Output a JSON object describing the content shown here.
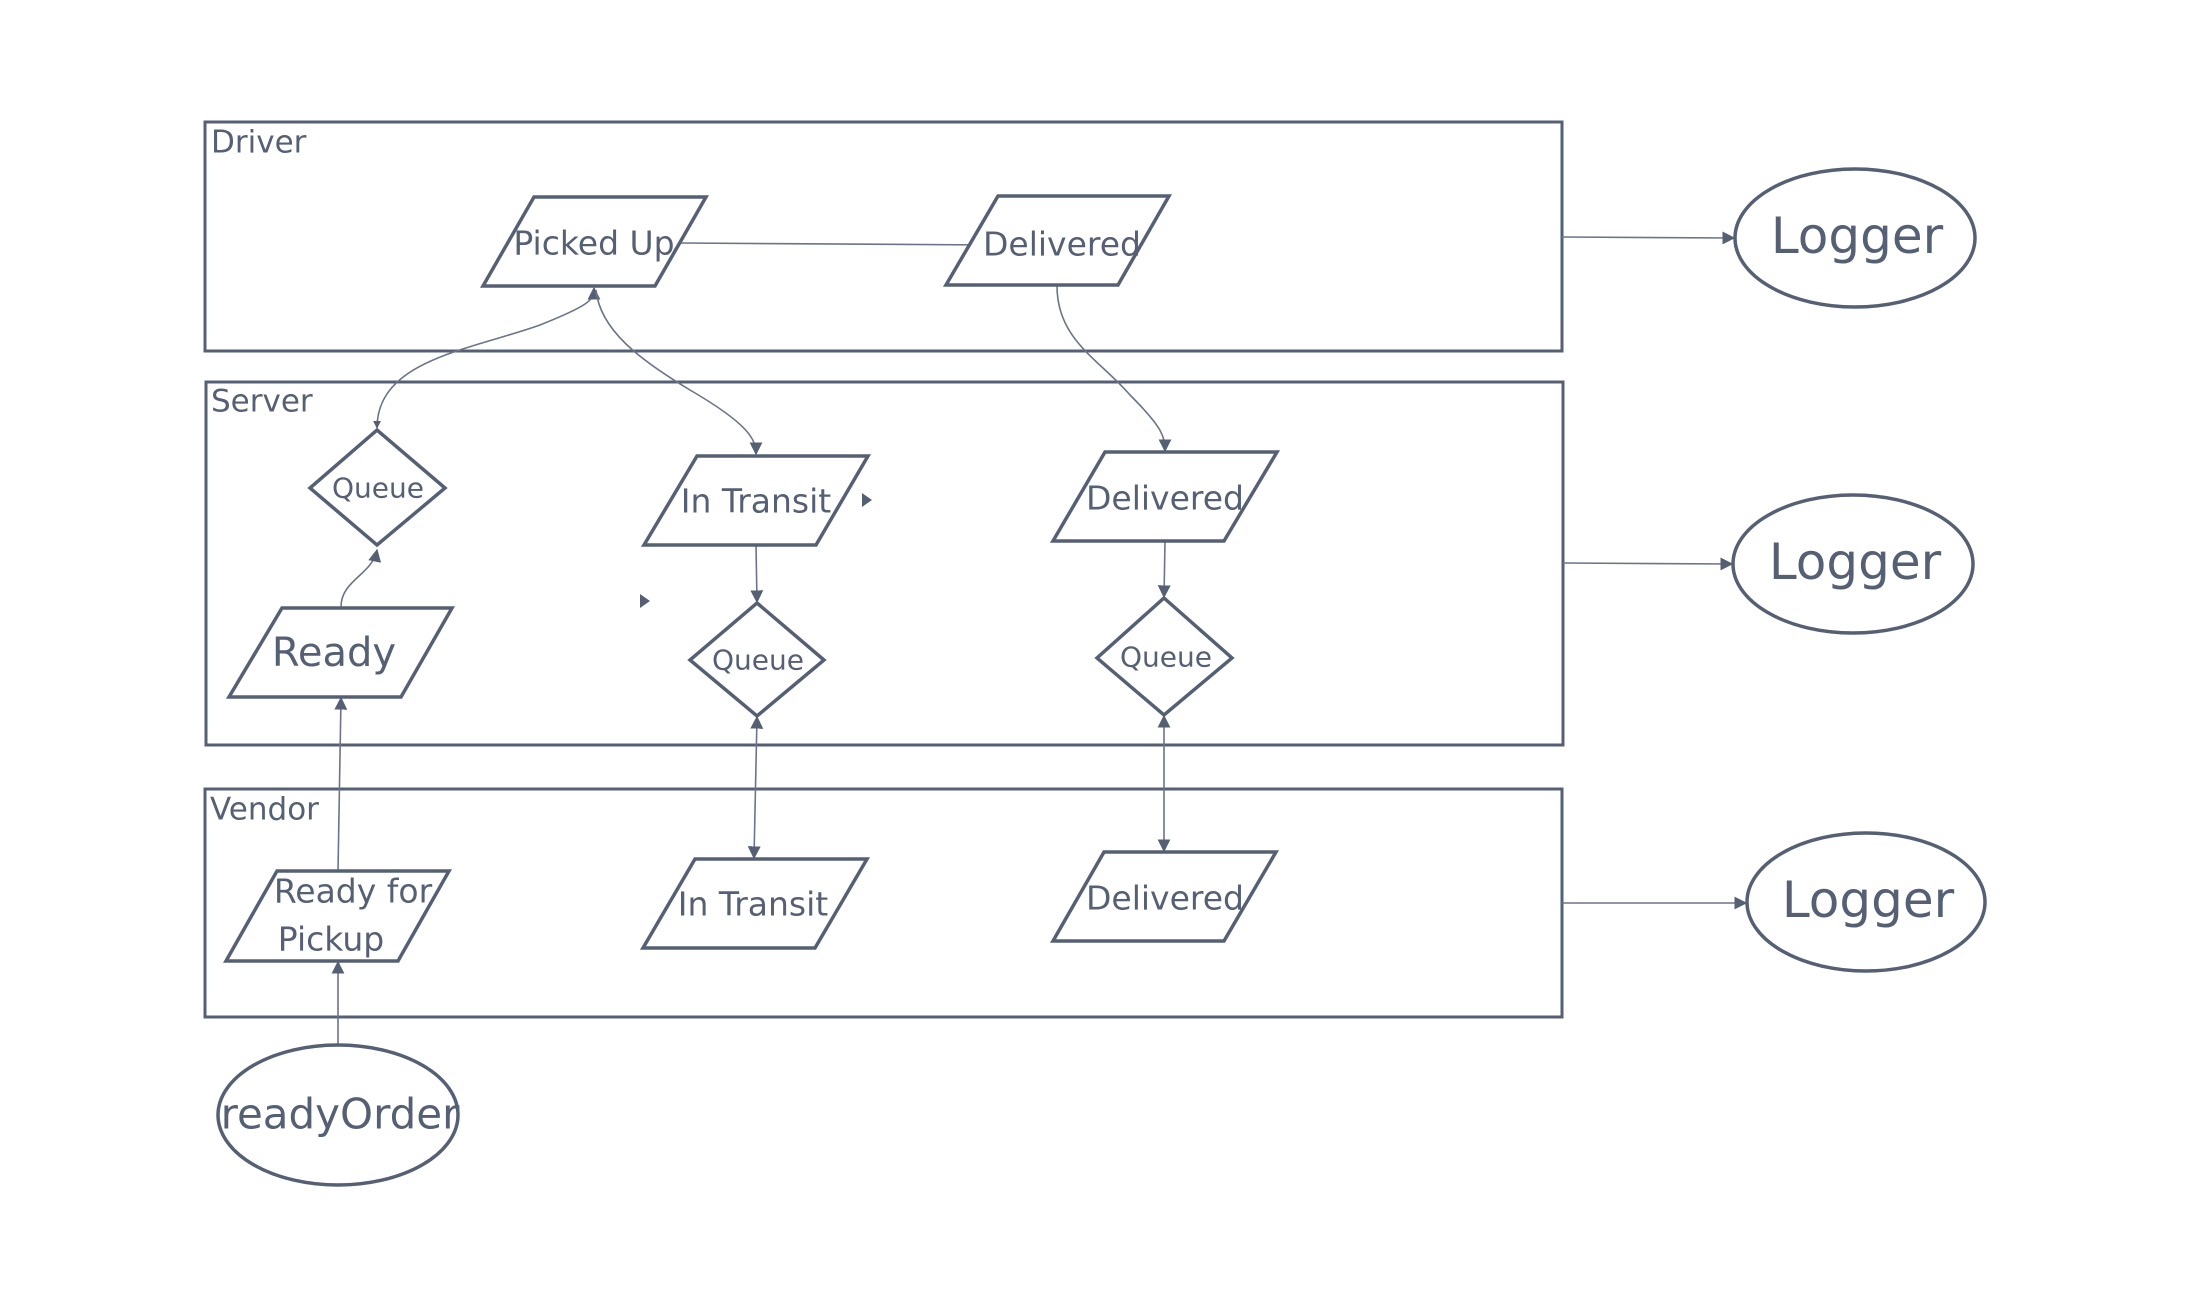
{
  "diagram": {
    "stroke_color": "#566074",
    "edge_color": "#6b7488",
    "lanes": [
      {
        "id": "driver",
        "title": "Driver"
      },
      {
        "id": "server",
        "title": "Server"
      },
      {
        "id": "vendor",
        "title": "Vendor"
      }
    ],
    "nodes": {
      "driver_picked_up": {
        "label": "Picked Up",
        "shape": "parallelogram",
        "lane": "driver"
      },
      "driver_delivered": {
        "label": "Delivered",
        "shape": "parallelogram",
        "lane": "driver"
      },
      "server_queue_1": {
        "label": "Queue",
        "shape": "diamond",
        "lane": "server"
      },
      "server_ready": {
        "label": "Ready",
        "shape": "parallelogram",
        "lane": "server"
      },
      "server_in_transit": {
        "label": "In Transit",
        "shape": "parallelogram",
        "lane": "server"
      },
      "server_queue_2": {
        "label": "Queue",
        "shape": "diamond",
        "lane": "server"
      },
      "server_delivered": {
        "label": "Delivered",
        "shape": "parallelogram",
        "lane": "server"
      },
      "server_queue_3": {
        "label": "Queue",
        "shape": "diamond",
        "lane": "server"
      },
      "vendor_ready_for_pickup": {
        "label_line1": "Ready for",
        "label_line2": "Pickup",
        "shape": "parallelogram",
        "lane": "vendor"
      },
      "vendor_in_transit": {
        "label": "In Transit",
        "shape": "parallelogram",
        "lane": "vendor"
      },
      "vendor_delivered": {
        "label": "Delivered",
        "shape": "parallelogram",
        "lane": "vendor"
      },
      "ready_order": {
        "label": "readyOrder",
        "shape": "ellipse"
      },
      "logger_driver": {
        "label": "Logger",
        "shape": "ellipse"
      },
      "logger_server": {
        "label": "Logger",
        "shape": "ellipse"
      },
      "logger_vendor": {
        "label": "Logger",
        "shape": "ellipse"
      }
    },
    "edges": [
      {
        "from": "driver_picked_up",
        "to": "driver_delivered",
        "arrow": "end"
      },
      {
        "from": "server_queue_1",
        "to": "driver_picked_up",
        "arrow": "both"
      },
      {
        "from": "driver_picked_up",
        "to": "server_in_transit",
        "arrow": "end"
      },
      {
        "from": "driver_delivered",
        "to": "server_delivered",
        "arrow": "end"
      },
      {
        "from": "server_ready",
        "to": "server_queue_1",
        "arrow": "end"
      },
      {
        "from": "server_in_transit",
        "to": "server_queue_2",
        "arrow": "end"
      },
      {
        "from": "server_delivered",
        "to": "server_queue_3",
        "arrow": "end"
      },
      {
        "from": "server_queue_2",
        "to": "vendor_in_transit",
        "arrow": "both"
      },
      {
        "from": "server_queue_3",
        "to": "vendor_delivered",
        "arrow": "both"
      },
      {
        "from": "vendor_ready_for_pickup",
        "to": "server_ready",
        "arrow": "end"
      },
      {
        "from": "ready_order",
        "to": "vendor_ready_for_pickup",
        "arrow": "end"
      },
      {
        "from": "driver",
        "to": "logger_driver",
        "arrow": "end"
      },
      {
        "from": "server",
        "to": "logger_server",
        "arrow": "end"
      },
      {
        "from": "vendor",
        "to": "logger_vendor",
        "arrow": "end"
      }
    ]
  }
}
